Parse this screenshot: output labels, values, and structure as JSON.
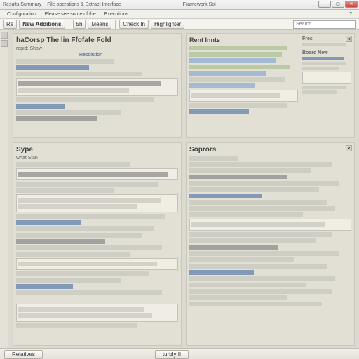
{
  "title": {
    "t1": "Results Summary",
    "t2": "File operations & Extract Interface",
    "t3": "Framework.Sol"
  },
  "win": {
    "min": "_",
    "max": "▢",
    "close": "✕"
  },
  "menu": {
    "m1": "Configuration",
    "m2": "Please see some of the",
    "m3": "Executions",
    "m4": "?"
  },
  "toolbar": {
    "b1": "Re",
    "b2": "New Additions",
    "b3": "5h",
    "b4": "Means",
    "b5": "Check In",
    "b6": "Highlighter",
    "searchPh": "Search..."
  },
  "panel1": {
    "title": "haCorsp The lin Ffofafe Fold",
    "sub": "rapid: Show",
    "sec": "Resolution"
  },
  "panel2": {
    "title": "Rent Innts",
    "sub": "",
    "aside": "Fres",
    "aside2": "Board New"
  },
  "panel3": {
    "title": "Sype",
    "sub": "what Slan"
  },
  "panel4": {
    "title": "Soprors",
    "sub": ""
  },
  "status": {
    "s1": "Relatives",
    "s2": "turbly II"
  }
}
